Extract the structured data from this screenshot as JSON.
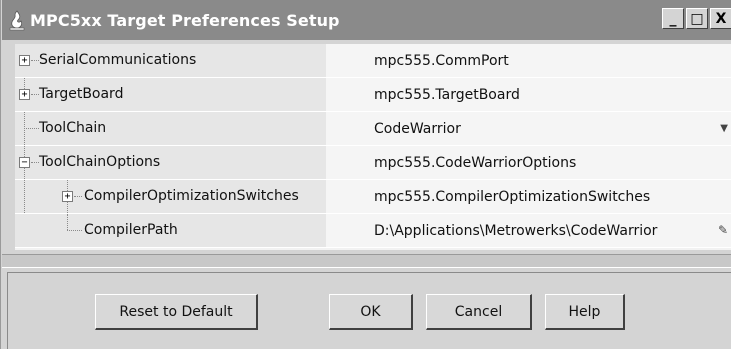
{
  "window": {
    "title": "MPC5xx Target Preferences Setup",
    "controls": {
      "minimize": "_",
      "maximize": "□",
      "close": "X"
    }
  },
  "tree": {
    "rows": [
      {
        "name": "SerialCommunications",
        "value": "mpc555.CommPort",
        "expander": "+"
      },
      {
        "name": "TargetBoard",
        "value": "mpc555.TargetBoard",
        "expander": "+"
      },
      {
        "name": "ToolChain",
        "value": "CodeWarrior",
        "value_icon": "dropdown-arrow-icon"
      },
      {
        "name": "ToolChainOptions",
        "value": "mpc555.CodeWarriorOptions",
        "expander": "−"
      },
      {
        "name": "CompilerOptimizationSwitches",
        "value": "mpc555.CompilerOptimizationSwitches",
        "expander": "+"
      },
      {
        "name": "CompilerPath",
        "value": "D:\\Applications\\Metrowerks\\CodeWarrior",
        "value_icon": "edit-pencil-icon"
      }
    ]
  },
  "buttons": {
    "reset": "Reset to Default",
    "ok": "OK",
    "cancel": "Cancel",
    "help": "Help"
  },
  "colors": {
    "titlebar": "#8a8a8a",
    "window_bg": "#d4d4d4",
    "name_cell": "#e6e6e6",
    "value_cell": "#f5f5f5"
  }
}
